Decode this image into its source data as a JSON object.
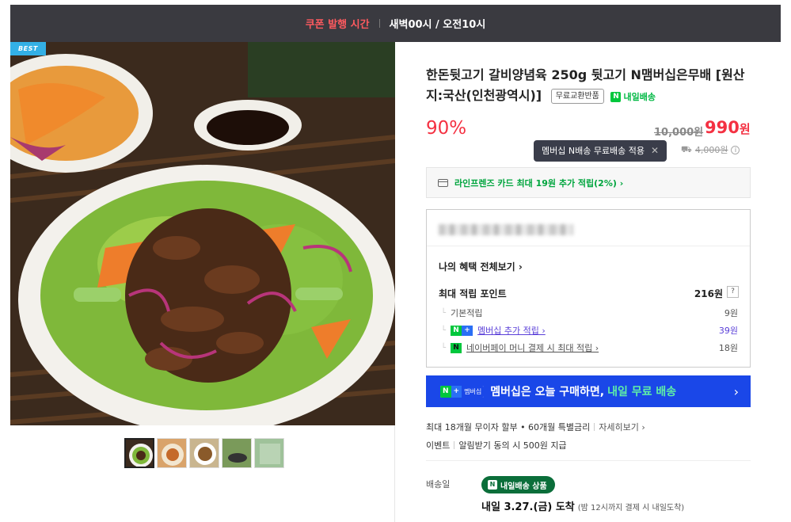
{
  "topbar": {
    "coupon_label": "쿠폰 발행 시간",
    "time": "새벽00시 / 오전10시"
  },
  "badge": "BEST",
  "product": {
    "title": "한돈뒷고기 갈비양념육 250g 뒷고기 N맴버십은무배 [원산지:국산(인천광역시)]",
    "tag_free_return": "무료교환반품",
    "tag_next_day": "내일배송",
    "discount": "90%",
    "old_price": "10,000원",
    "price": "990",
    "price_unit": "원"
  },
  "tooltip": {
    "text": "멤버십 N배송 무료배송 적용",
    "close": "✕"
  },
  "shipping_fee": "4,000원",
  "card_benefit": "라인프렌즈 카드 최대 19원 추가 적립(2%) ›",
  "benefits": {
    "my_benefits_link": "나의 혜택 전체보기 ›",
    "max_points_label": "최대 적립 포인트",
    "max_points_value": "216원",
    "help": "?",
    "rows": [
      {
        "label": "기본적립",
        "value": "9원"
      },
      {
        "label": "멤버십 추가 적립 ›",
        "value": "39원"
      },
      {
        "label": "네이버페이 머니 결제 시 최대 적립 ›",
        "value": "18원"
      }
    ]
  },
  "membership_banner": {
    "badge": "멤버십",
    "text": "멤버십은 오늘 구매하면,",
    "highlight": "내일 무료 배송",
    "arrow": "›"
  },
  "installment": {
    "text": "최대 18개월 무이자 할부 • 60개월 특별금리",
    "more": "자세히보기 ›"
  },
  "event": {
    "label": "이벤트",
    "text": "알림받기 동의 시 500원 지급"
  },
  "delivery": {
    "label": "배송일",
    "pill": "내일배송 상품",
    "arrival": "내일 3.27.(금) 도착",
    "arrival_note": "(밤 12시까지 결제 시 내일도착)"
  },
  "colors": {
    "accent_red": "#f43142",
    "naver_green": "#00c73c",
    "banner_blue": "#1a47e8",
    "topbar": "#3a3a40"
  }
}
